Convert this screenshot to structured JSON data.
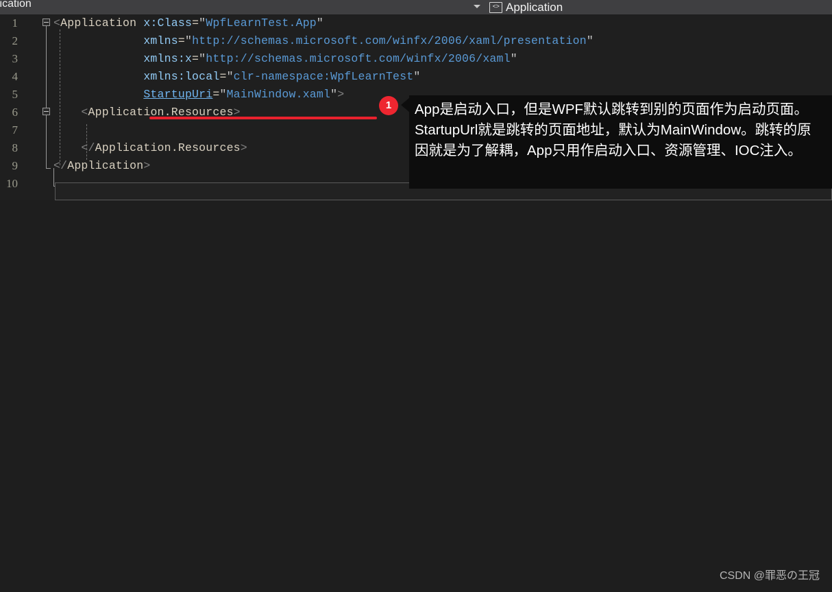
{
  "window": {
    "background_color": "#1e1e1e"
  },
  "topbar": {
    "background_color": "#3f3f41",
    "left_label": "lication",
    "dropdown_icon": "chevron-down-icon",
    "tab": {
      "icon": "code-brackets-icon",
      "icon_glyph": "<>",
      "label": "Application"
    }
  },
  "editor": {
    "background_color": "#1f1f1f",
    "language": "xaml",
    "line_numbers": [
      "1",
      "2",
      "3",
      "4",
      "5",
      "6",
      "7",
      "8",
      "9",
      "10"
    ],
    "lines": [
      {
        "number": "1",
        "tokens": [
          {
            "text": "<",
            "type": "brk"
          },
          {
            "text": "Application",
            "type": "tag"
          },
          {
            "text": " ",
            "type": "plain"
          },
          {
            "text": "x:Class",
            "type": "attr"
          },
          {
            "text": "=",
            "type": "eq"
          },
          {
            "text": "\"",
            "type": "str"
          },
          {
            "text": "WpfLearnTest.App",
            "type": "val"
          },
          {
            "text": "\"",
            "type": "str"
          }
        ]
      },
      {
        "number": "2",
        "tokens": [
          {
            "text": "             ",
            "type": "plain"
          },
          {
            "text": "xmlns",
            "type": "attr"
          },
          {
            "text": "=",
            "type": "eq"
          },
          {
            "text": "\"",
            "type": "str"
          },
          {
            "text": "http://schemas.microsoft.com/winfx/2006/xaml/presentation",
            "type": "val"
          },
          {
            "text": "\"",
            "type": "str"
          }
        ]
      },
      {
        "number": "3",
        "tokens": [
          {
            "text": "             ",
            "type": "plain"
          },
          {
            "text": "xmlns:x",
            "type": "attr"
          },
          {
            "text": "=",
            "type": "eq"
          },
          {
            "text": "\"",
            "type": "str"
          },
          {
            "text": "http://schemas.microsoft.com/winfx/2006/xaml",
            "type": "val"
          },
          {
            "text": "\"",
            "type": "str"
          }
        ]
      },
      {
        "number": "4",
        "tokens": [
          {
            "text": "             ",
            "type": "plain"
          },
          {
            "text": "xmlns:local",
            "type": "attr"
          },
          {
            "text": "=",
            "type": "eq"
          },
          {
            "text": "\"",
            "type": "str"
          },
          {
            "text": "clr-namespace:WpfLearnTest",
            "type": "val"
          },
          {
            "text": "\"",
            "type": "str"
          }
        ]
      },
      {
        "number": "5",
        "tokens": [
          {
            "text": "             ",
            "type": "plain"
          },
          {
            "text": "StartupUri",
            "type": "link"
          },
          {
            "text": "=",
            "type": "eq"
          },
          {
            "text": "\"",
            "type": "str"
          },
          {
            "text": "MainWindow.xaml",
            "type": "val"
          },
          {
            "text": "\"",
            "type": "str"
          },
          {
            "text": ">",
            "type": "brk"
          }
        ]
      },
      {
        "number": "6",
        "tokens": [
          {
            "text": "    ",
            "type": "plain"
          },
          {
            "text": "<",
            "type": "brk"
          },
          {
            "text": "Application.Resources",
            "type": "tag"
          },
          {
            "text": ">",
            "type": "brk"
          }
        ]
      },
      {
        "number": "7",
        "tokens": []
      },
      {
        "number": "8",
        "tokens": [
          {
            "text": "    ",
            "type": "plain"
          },
          {
            "text": "</",
            "type": "brk"
          },
          {
            "text": "Application.Resources",
            "type": "tag"
          },
          {
            "text": ">",
            "type": "brk"
          }
        ]
      },
      {
        "number": "9",
        "tokens": [
          {
            "text": "</",
            "type": "brk"
          },
          {
            "text": "Application",
            "type": "tag"
          },
          {
            "text": ">",
            "type": "brk"
          }
        ]
      },
      {
        "number": "10",
        "tokens": []
      }
    ],
    "fold_markers": [
      "1",
      "6"
    ],
    "current_line": "10"
  },
  "annotation": {
    "underline_color": "#e8212d",
    "badge": {
      "label": "1",
      "color": "#ee2630"
    },
    "note": {
      "background_color": "#0d0d0d",
      "text": "App是启动入口，但是WPF默认跳转到别的页面作为启动页面。StartupUrl就是跳转的页面地址，默认为MainWindow。跳转的原因就是为了解耦，App只用作启动入口、资源管理、IOC注入。"
    }
  },
  "watermark": {
    "text": "CSDN @罪恶の王冠"
  }
}
